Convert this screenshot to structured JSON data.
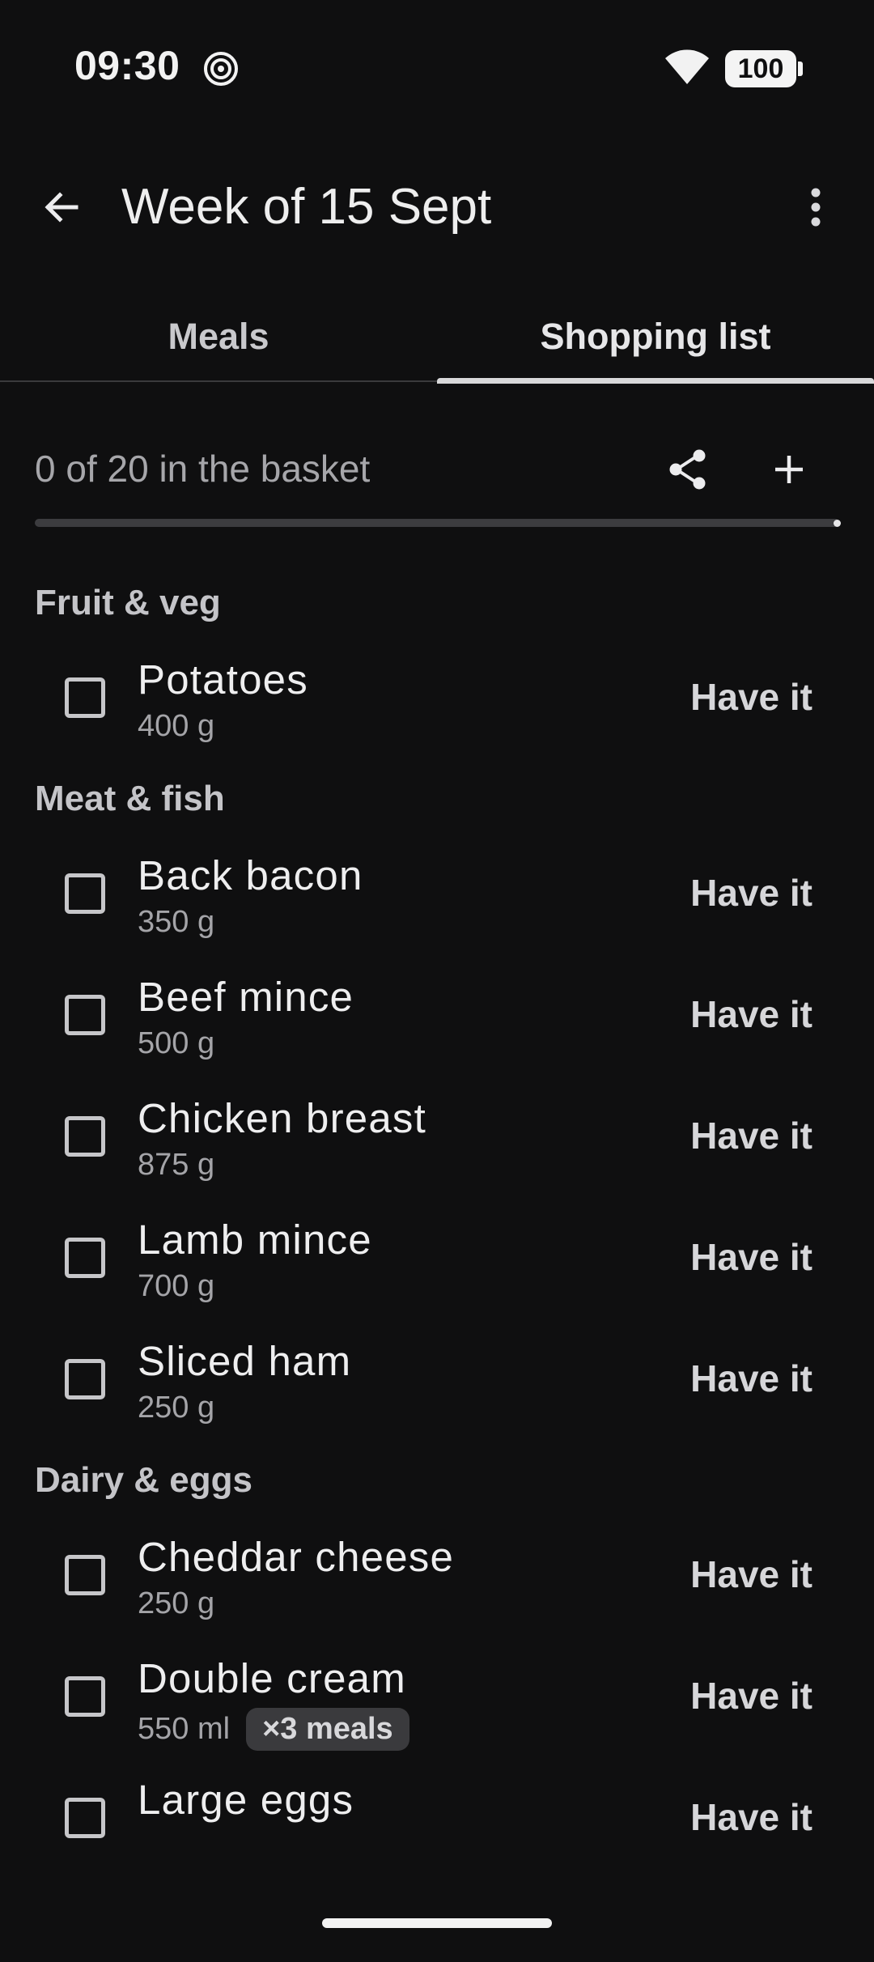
{
  "status_bar": {
    "time": "09:30",
    "battery": "100",
    "icons": [
      "spiral-icon",
      "wifi-icon",
      "battery-icon"
    ]
  },
  "app_bar": {
    "title": "Week of 15 Sept",
    "back_icon": "arrow-left-icon",
    "menu_icon": "more-vert-icon"
  },
  "tabs": [
    {
      "label": "Meals",
      "selected": false
    },
    {
      "label": "Shopping list",
      "selected": true
    }
  ],
  "basket": {
    "summary": "0 of 20 in the basket",
    "checked": 0,
    "total": 20,
    "share_icon": "share-icon",
    "add_icon": "plus-icon"
  },
  "sections": [
    {
      "title": "Fruit & veg",
      "items": [
        {
          "name": "Potatoes",
          "qty": "400 g",
          "action": "Have it"
        }
      ]
    },
    {
      "title": "Meat & fish",
      "items": [
        {
          "name": "Back bacon",
          "qty": "350 g",
          "action": "Have it"
        },
        {
          "name": "Beef mince",
          "qty": "500 g",
          "action": "Have it"
        },
        {
          "name": "Chicken breast",
          "qty": "875 g",
          "action": "Have it"
        },
        {
          "name": "Lamb mince",
          "qty": "700 g",
          "action": "Have it"
        },
        {
          "name": "Sliced ham",
          "qty": "250 g",
          "action": "Have it"
        }
      ]
    },
    {
      "title": "Dairy & eggs",
      "items": [
        {
          "name": "Cheddar cheese",
          "qty": "250 g",
          "action": "Have it"
        },
        {
          "name": "Double cream",
          "qty": "550 ml",
          "badge": "×3 meals",
          "action": "Have it"
        },
        {
          "name": "Large eggs",
          "qty": "",
          "action": "Have it"
        }
      ]
    }
  ],
  "colors": {
    "background": "#0f0f10",
    "text_primary": "#eeeeef",
    "text_secondary": "#a4a4a8",
    "indicator": "#d8d8da"
  }
}
